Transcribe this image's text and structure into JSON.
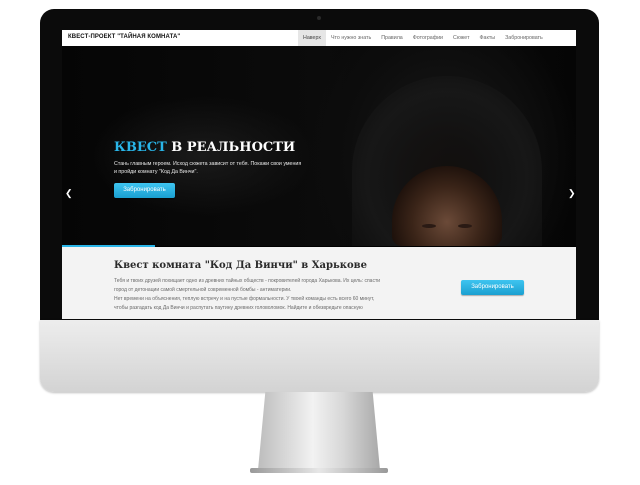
{
  "navbar": {
    "brand": "КВЕСТ-ПРОЕКТ \"ТАЙНАЯ КОМНАТА\"",
    "links": [
      "Наверх",
      "Что нужно знать",
      "Правила",
      "Фотографии",
      "Сюжет",
      "Факты",
      "Забронировать"
    ],
    "active_index": 0
  },
  "hero": {
    "title_accent": "КВЕСТ",
    "title_rest": " В РЕАЛЬНОСТИ",
    "text_line1": "Стань главным героем. Исход сюжета зависит от тебя. Покажи свои умения",
    "text_line2": "и пройди комнату \"Код Да Винчи\".",
    "button_label": "Забронировать",
    "prev_icon": "chevron-left-icon",
    "next_icon": "chevron-right-icon",
    "slide_progress": 0.18
  },
  "content": {
    "title": "Квест комната \"Код Да Винчи\" в Харькове",
    "line1": "Тебя и твоих друзей похищает одно из древних тайных обществ - покровителей города Харькова. Их цель: спасти",
    "line2": "город от детонации самой смертельной современной бомбы - антиматерии.",
    "line3": "Нет времени на объяснения, теплую встречу и на пустые формальности. У твоей команды есть всего 60 минут,",
    "line4": "чтобы разгадать код Да Винчи и распутать паутину древних головоломок. Найдите и обезвредьте опасную",
    "button_label": "Забронировать"
  },
  "colors": {
    "accent": "#29b5e8",
    "hero_bg": "#0b0b0b",
    "content_bg": "#f3f3f3"
  }
}
